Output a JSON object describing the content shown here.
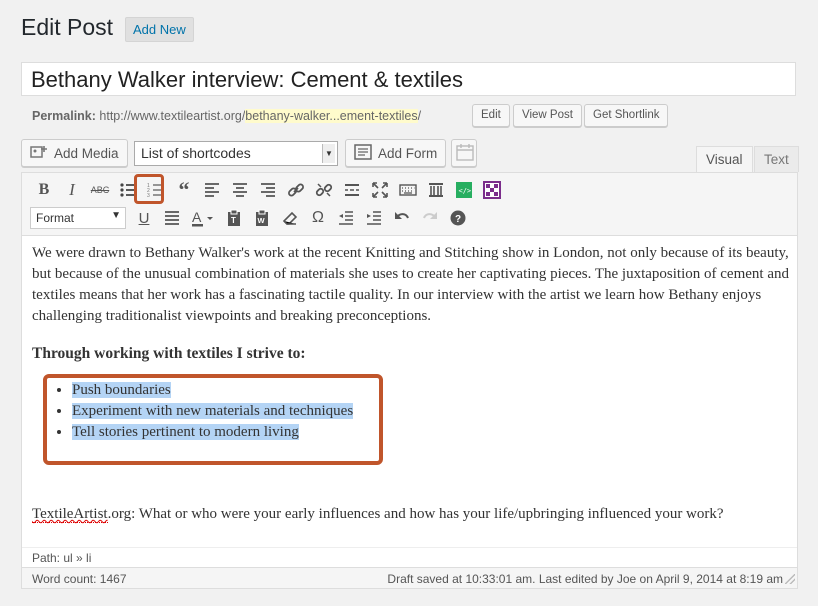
{
  "header": {
    "page_title": "Edit Post",
    "add_new": "Add New"
  },
  "post": {
    "title": "Bethany Walker interview: Cement & textiles"
  },
  "permalink": {
    "label": "Permalink:",
    "base": "http://www.textileartist.org/",
    "slug": "bethany-walker...ement-textiles",
    "trail": "/",
    "edit": "Edit",
    "view_post": "View Post",
    "get_shortlink": "Get Shortlink"
  },
  "media_bar": {
    "add_media": "Add Media",
    "shortcodes": "List of shortcodes",
    "add_form": "Add Form"
  },
  "tabs": {
    "visual": "Visual",
    "text": "Text"
  },
  "toolbar": {
    "format_label": "Format"
  },
  "content": {
    "paragraph": "We were drawn to Bethany Walker's work at the recent Knitting and Stitching show in London, not only because of its beauty, but because of the unusual combination of materials she uses to create her captivating pieces. The juxtaposition of cement and textiles means that her work has a fascinating tactile quality. In our interview with the artist we learn how Bethany enjoys challenging traditionalist viewpoints and breaking preconceptions.",
    "heading": "Through working with textiles I strive to:",
    "list": [
      "Push boundaries",
      "Experiment with new materials and techniques",
      "Tell stories pertinent to modern living"
    ],
    "question_site": "TextileArtist",
    "question_rest": ".org: What or who were your early influences and how has your life/upbringing influenced your work?"
  },
  "footer": {
    "path": "Path: ul » li",
    "word_count": "Word count: 1467",
    "saved": "Draft saved at 10:33:01 am. Last edited by Joe on April 9, 2014 at 8:19 am"
  },
  "colors": {
    "highlight_border": "#c0552b",
    "selection": "#b4d4f5",
    "link": "#0073aa"
  }
}
